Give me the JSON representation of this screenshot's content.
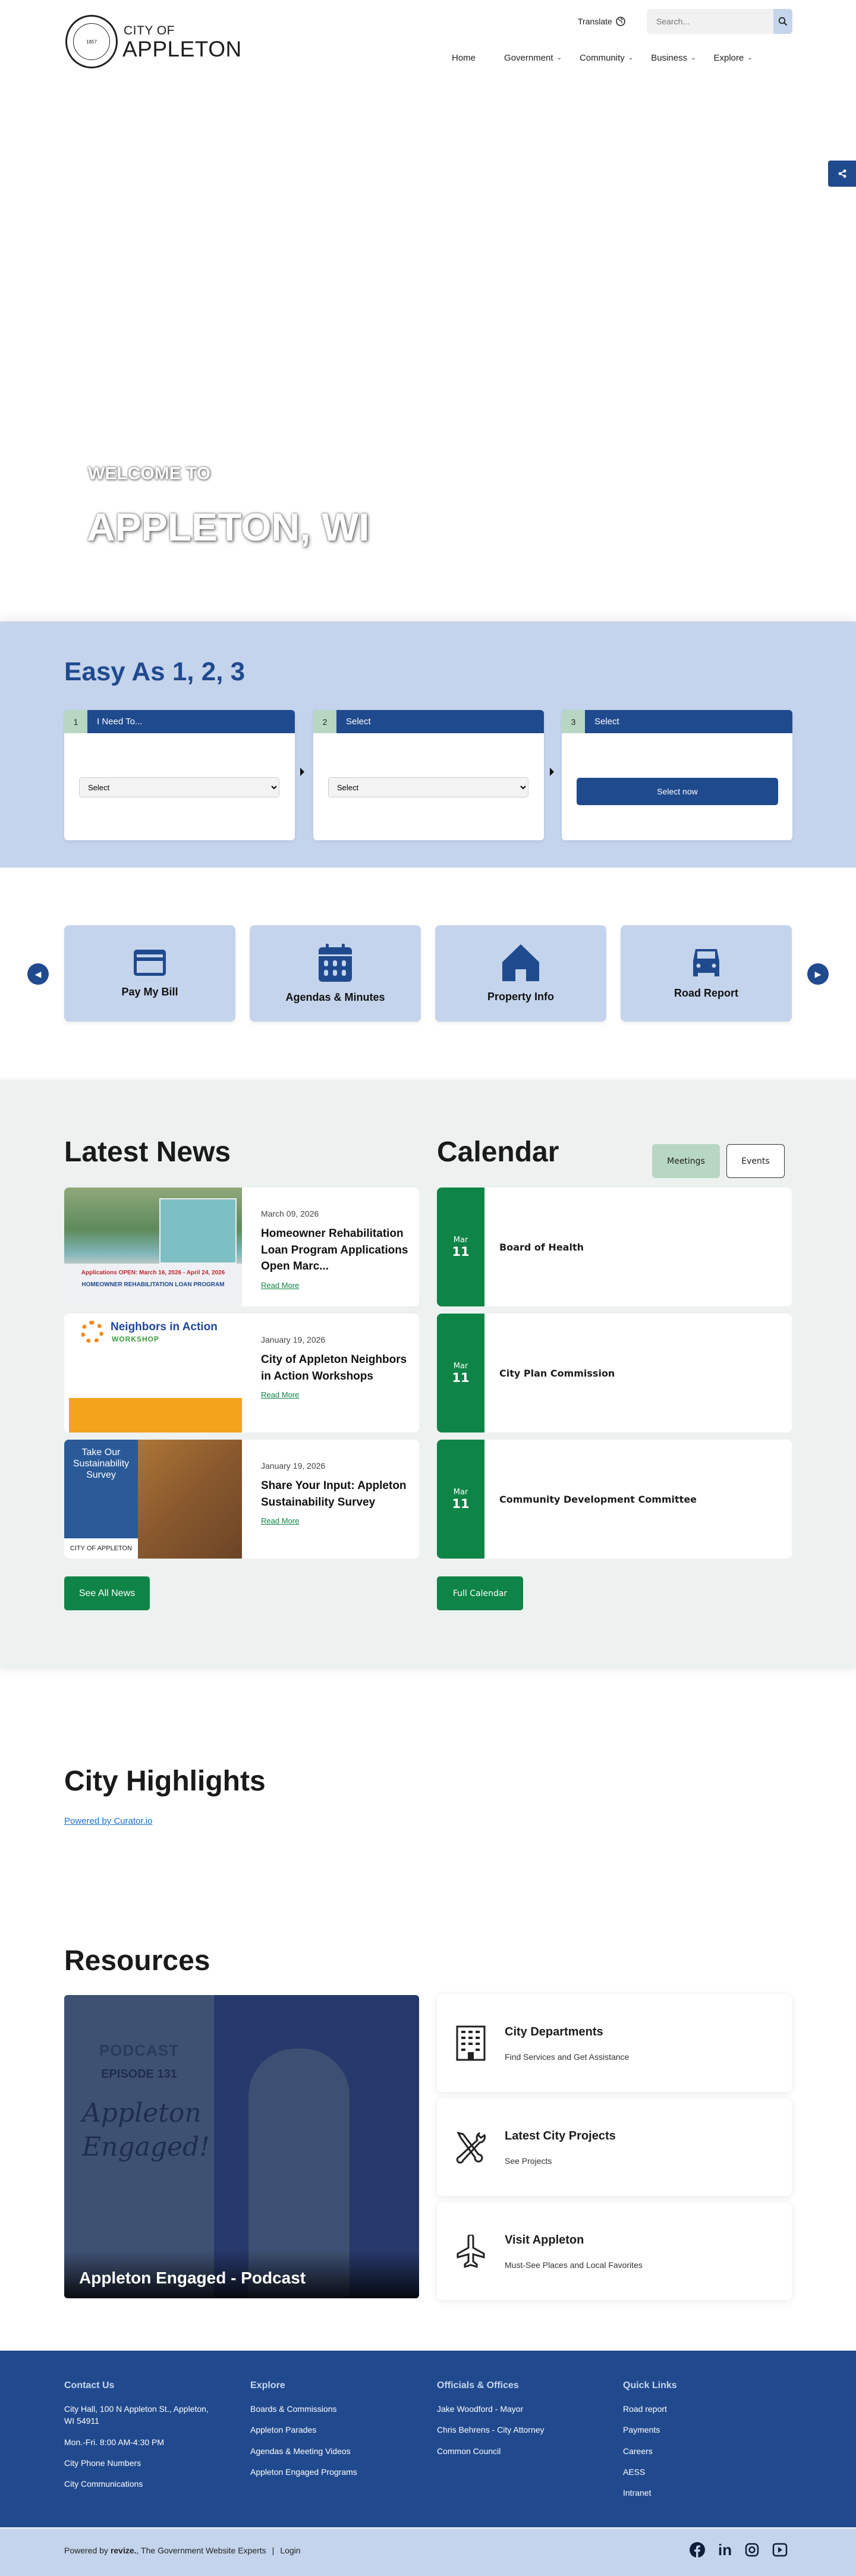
{
  "header": {
    "seal_text": "CITY OF APPLETON · INCORPORATED 1857 · WISCONSIN",
    "logo_line1": "CITY OF",
    "logo_line2": "APPLETON",
    "translate": "Translate",
    "search_placeholder": "Search...",
    "nav": [
      {
        "label": "Home",
        "has_dropdown": false
      },
      {
        "label": "Government",
        "has_dropdown": true
      },
      {
        "label": "Community",
        "has_dropdown": true
      },
      {
        "label": "Business",
        "has_dropdown": true
      },
      {
        "label": "Explore",
        "has_dropdown": true
      }
    ]
  },
  "hero": {
    "welcome": "WELCOME TO",
    "title": "APPLETON, WI"
  },
  "easy": {
    "title": "Easy As 1, 2, 3",
    "steps": [
      {
        "num": "1",
        "label": "I Need To...",
        "select": "Select"
      },
      {
        "num": "2",
        "label": "Select",
        "select": "Select"
      },
      {
        "num": "3",
        "label": "Select",
        "button": "Select now"
      }
    ]
  },
  "quick_links": [
    {
      "label": "Pay My Bill",
      "icon": "credit-card-icon"
    },
    {
      "label": "Agendas & Minutes",
      "icon": "calendar-icon"
    },
    {
      "label": "Property Info",
      "icon": "house-icon"
    },
    {
      "label": "Road Report",
      "icon": "car-icon"
    }
  ],
  "news": {
    "title": "Latest News",
    "read_more": "Read More",
    "see_all": "See All News",
    "items": [
      {
        "date": "March 09, 2026",
        "title": "Homeowner Rehabilitation Loan Program Applications Open Marc...",
        "img_line1": "Applications OPEN: March 16, 2026 - April 24, 2026",
        "img_line2": "HOMEOWNER REHABILITATION LOAN PROGRAM"
      },
      {
        "date": "January 19, 2026",
        "title": "City of Appleton Neighbors in Action Workshops",
        "img_line1": "Neighbors in Action",
        "img_line2": "WORKSHOP"
      },
      {
        "date": "January 19, 2026",
        "title": "Share Your Input: Appleton Sustainability Survey",
        "img_line1": "Take Our Sustainability Survey",
        "img_line2": "CITY OF APPLETON"
      }
    ]
  },
  "calendar": {
    "title": "Calendar",
    "tabs": [
      {
        "label": "Meetings",
        "active": true
      },
      {
        "label": "Events",
        "active": false
      }
    ],
    "items": [
      {
        "month": "Mar",
        "day": "11",
        "name": "Board of Health"
      },
      {
        "month": "Mar",
        "day": "11",
        "name": "City Plan Commission"
      },
      {
        "month": "Mar",
        "day": "11",
        "name": "Community Development Committee"
      }
    ],
    "full_calendar": "Full Calendar"
  },
  "highlights": {
    "title": "City Highlights",
    "powered": "Powered by Curator.io"
  },
  "resources": {
    "title": "Resources",
    "feature": {
      "caption": "Appleton Engaged - Podcast",
      "img_line1": "PODCAST",
      "img_line2": "EPISODE 131",
      "img_line3": "Appleton Engaged!"
    },
    "cards": [
      {
        "title": "City Departments",
        "subtitle": "Find Services and Get Assistance",
        "icon": "building-icon"
      },
      {
        "title": "Latest City Projects",
        "subtitle": "See Projects",
        "icon": "tools-icon"
      },
      {
        "title": "Visit Appleton",
        "subtitle": "Must-See Places and Local Favorites",
        "icon": "airplane-icon"
      }
    ]
  },
  "footer": {
    "columns": [
      {
        "title": "Contact Us",
        "items": [
          "City Hall, 100 N Appleton St., Appleton, WI 54911",
          "Mon.-Fri. 8:00 AM-4:30 PM",
          "City Phone Numbers",
          "City Communications"
        ]
      },
      {
        "title": "Explore",
        "items": [
          "Boards & Commissions",
          "Appleton Parades",
          "Agendas & Meeting Videos",
          "Appleton Engaged Programs"
        ]
      },
      {
        "title": "Officials & Offices",
        "items": [
          "Jake Woodford - Mayor",
          "Chris Behrens - City Attorney",
          "Common Council"
        ]
      },
      {
        "title": "Quick Links",
        "items": [
          "Road report",
          "Payments",
          "Careers",
          "AESS",
          "Intranet"
        ]
      }
    ],
    "powered_prefix": "Powered by",
    "powered_brand": "revize.",
    "powered_suffix": ", The Government Website Experts",
    "separator": "|",
    "login": "Login"
  },
  "colors": {
    "brand_blue": "#204a8e",
    "light_blue": "#c4d4ec",
    "green": "#0e8446",
    "mint": "#b7d7c2"
  }
}
